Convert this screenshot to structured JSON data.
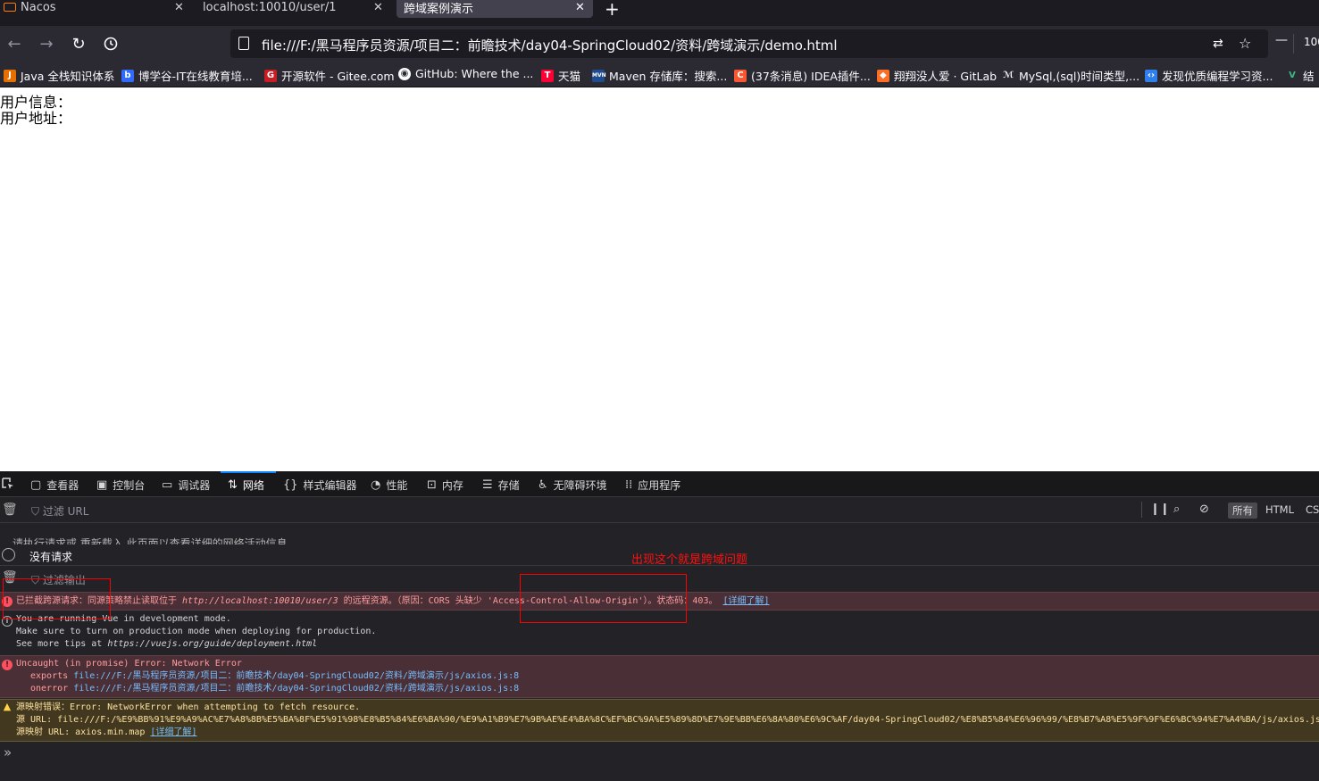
{
  "tabs": [
    {
      "title": "Nacos",
      "icon": "nacos-icon"
    },
    {
      "title": "localhost:10010/user/1",
      "icon": "page-icon"
    },
    {
      "title": "跨域案例演示",
      "icon": "page-icon"
    }
  ],
  "toolbar": {
    "url": "file:///F:/黑马程序员资源/项目二：前瞻技术/day04-SpringCloud02/资料/跨域演示/demo.html",
    "zoom": "100"
  },
  "bookmarks": [
    {
      "label": "Java 全栈知识体系",
      "icon": "java-icon",
      "color": "#e76f00"
    },
    {
      "label": "博学谷-IT在线教育培...",
      "icon": "boxuegu-icon",
      "color": "#2f6bff"
    },
    {
      "label": "开源软件 - Gitee.com",
      "icon": "gitee-icon",
      "color": "#c71d23"
    },
    {
      "label": "GitHub: Where the ...",
      "icon": "github-icon",
      "color": "#ffffff"
    },
    {
      "label": "天猫",
      "icon": "tmall-icon",
      "color": "#ff0036"
    },
    {
      "label": "Maven 存储库：搜索...",
      "icon": "maven-icon",
      "color": "#1f4b8f"
    },
    {
      "label": "(37条消息) IDEA插件...",
      "icon": "csdn-icon",
      "color": "#fc5531"
    },
    {
      "label": "翔翔没人爱 · GitLab",
      "icon": "gitlab-icon",
      "color": "#fc6d26"
    },
    {
      "label": "MySql,(sql)时间类型,...",
      "icon": "mysql-icon",
      "color": "#ffffff"
    },
    {
      "label": "发现优质编程学习资...",
      "icon": "code-icon",
      "color": "#2f80ed"
    },
    {
      "label": "结",
      "icon": "vue-icon",
      "color": "#41b883"
    }
  ],
  "page": {
    "user_info_label": "用户信息：",
    "user_addr_label": "用户地址："
  },
  "devtools": {
    "tabs": [
      {
        "label": "查看器",
        "icon": "inspector-icon"
      },
      {
        "label": "控制台",
        "icon": "console-icon"
      },
      {
        "label": "调试器",
        "icon": "debugger-icon"
      },
      {
        "label": "网络",
        "icon": "network-icon"
      },
      {
        "label": "样式编辑器",
        "icon": "style-editor-icon"
      },
      {
        "label": "性能",
        "icon": "performance-icon"
      },
      {
        "label": "内存",
        "icon": "memory-icon"
      },
      {
        "label": "存储",
        "icon": "storage-icon"
      },
      {
        "label": "无障碍环境",
        "icon": "accessibility-icon"
      },
      {
        "label": "应用程序",
        "icon": "application-icon"
      }
    ],
    "active_tab": "网络",
    "network": {
      "filter_placeholder": "过滤 URL",
      "type_filters": [
        "所有",
        "HTML",
        "CSS"
      ],
      "no_requests": "没有请求",
      "ghost_text": "请执行请求或 重新载入 此页面以查看详细的网络活动信息"
    },
    "console": {
      "filter_placeholder": "过滤输出",
      "annotation": "出现这个就是跨域问题",
      "cors_error": {
        "prefix": "已拦截跨源请求：同源策略禁止读取位于 ",
        "url": "http://localhost:10010/user/3",
        "middle": " 的远程资源。（原因：CORS 头缺少 ",
        "header": "'Access-Control-Allow-Origin'",
        "suffix": "）。状态码：403。",
        "learn": "[详细了解]"
      },
      "vue_info": [
        "You are running Vue in development mode.",
        "Make sure to turn on production mode when deploying for production.",
        "See more tips at ",
        "https://vuejs.org/guide/deployment.html"
      ],
      "uncaught": {
        "title": "Uncaught (in promise) Error: Network Error",
        "frames": [
          {
            "fn": "exports",
            "loc": "file:///F:/黑马程序员资源/项目二：前瞻技术/day04-SpringCloud02/资料/跨域演示/js/axios.js:8"
          },
          {
            "fn": "onerror",
            "loc": "file:///F:/黑马程序员资源/项目二：前瞻技术/day04-SpringCloud02/资料/跨域演示/js/axios.js:8"
          }
        ]
      },
      "sourcemap_warn": {
        "line1": "源映射错误：Error: NetworkError when attempting to fetch resource.",
        "line2": "源 URL: file:///F:/%E9%BB%91%E9%A9%AC%E7%A8%8B%E5%BA%8F%E5%91%98%E8%B5%84%E6%BA%90/%E9%A1%B9%E7%9B%AE%E4%BA%8C%EF%BC%9A%E5%89%8D%E7%9E%BB%E6%8A%80%E6%9C%AF/day04-SpringCloud02/%E8%B5%84%E6%96%99/%E8%B7%A8%E5%9F%9F%E6%BC%94%E7%A4%BA/js/axios.js",
        "line3": "源映射 URL: axios.min.map",
        "learn": "[详细了解]"
      }
    }
  }
}
